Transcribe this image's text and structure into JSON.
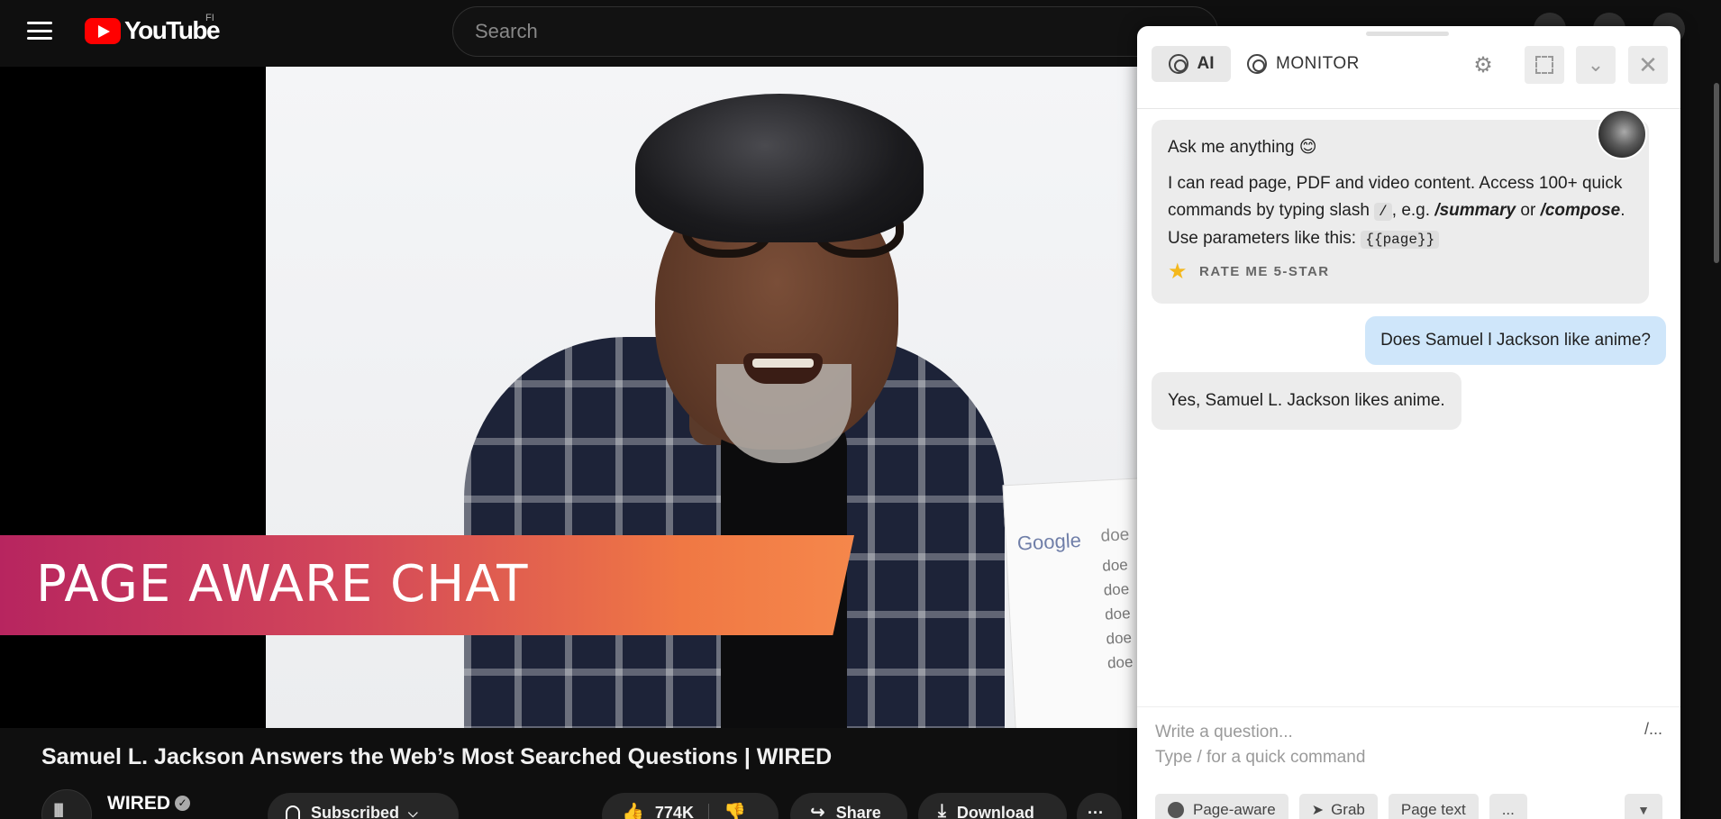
{
  "header": {
    "logo_text": "YouTube",
    "region": "FI",
    "search_placeholder": "Search"
  },
  "video": {
    "banner_text": "PAGE AWARE CHAT",
    "google_logo": "Google",
    "google_lines": [
      "doe",
      "doe",
      "doe",
      "doe",
      "doe",
      "doe"
    ],
    "title": "Samuel L. Jackson Answers the Web’s Most Searched Questions | WIRED"
  },
  "channel": {
    "name": "WIRED",
    "subscribe_label": "Subscribed",
    "like_count": "774K",
    "share_label": "Share",
    "download_label": "Download",
    "more_label": "···"
  },
  "panel": {
    "tab_ai": "AI",
    "tab_monitor": "MONITOR",
    "welcome_title": "Ask me anything 😊",
    "welcome_body_1": "I can read page, PDF and video content. Access 100+ quick commands by typing slash",
    "slash_code": "/",
    "welcome_body_2": ", e.g.",
    "cmd_summary": "/summary",
    "or_word": "or",
    "cmd_compose": "/compose",
    "welcome_body_3": ". Use parameters like this:",
    "param_code": "{{page}}",
    "rate_label": "RATE ME 5-STAR",
    "user_message": "Does Samuel l Jackson like anime?",
    "ai_reply": "Yes, Samuel L. Jackson likes anime.",
    "input_placeholder": "Write a question...\nType / for a quick command",
    "slash_button": "/...",
    "tools": {
      "page_aware": "Page-aware",
      "grab": "Grab",
      "page_text": "Page text",
      "more": "..."
    }
  }
}
